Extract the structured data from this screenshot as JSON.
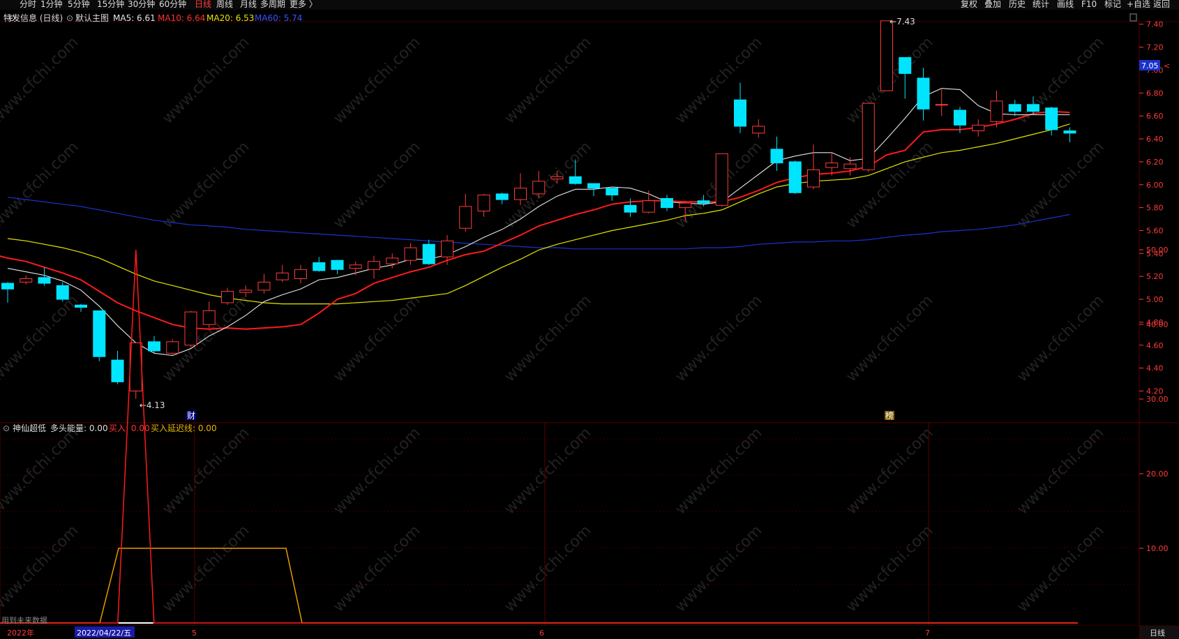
{
  "toolbar": {
    "left": [
      "分时",
      "1分钟",
      "5分钟",
      "15分钟",
      "30分钟",
      "60分钟",
      "日线",
      "周线",
      "月线",
      "多周期",
      "更多 〉"
    ],
    "active": "日线",
    "right": [
      "复权",
      "叠加",
      "历史",
      "统计",
      "画线",
      "F10",
      "标记",
      "+自选",
      "返回"
    ]
  },
  "main": {
    "stock_title": "特发信息 (日线)",
    "template_label": "默认主图",
    "ma5_label": "MA5: 6.61",
    "ma10_label": "MA10: 6.64",
    "ma20_label": "MA20: 6.53",
    "ma60_label": "MA60: 5.74",
    "high_marker": "7.43",
    "low_marker": "4.13",
    "current_price": "7.05",
    "event_cai": "财",
    "event_bang": "榜"
  },
  "sub": {
    "indicator_name": "神仙超低",
    "energy_label": "多头能量: 0.00",
    "buy_label": "买入: 0.00",
    "delay_label": "买入延迟线: 0.00",
    "future_note": "用到未来数据"
  },
  "bottom": {
    "year_label": "2022年",
    "selected_date": "2022/04/22/五",
    "month_5": "5",
    "month_6": "6",
    "month_7": "7",
    "period_tab": "日线"
  },
  "watermark": "www.cfchi.com",
  "colors": {
    "up": "#ff3b3b",
    "down": "#00e5ff",
    "ma5": "#e6e6e6",
    "ma10": "#ff1a1a",
    "ma20": "#e6e600",
    "ma60": "#1a33cc",
    "buy": "#ff1a1a",
    "delay": "#e69900",
    "bg": "#000000",
    "grid": "#3a0000"
  },
  "chart_data": {
    "type": "candlestick",
    "price_axis": {
      "min": 4.13,
      "max": 7.43,
      "ticks": [
        "7.40",
        "7.20",
        "7.00",
        "6.80",
        "6.60",
        "6.40",
        "6.20",
        "6.00",
        "5.80",
        "5.60",
        "5.40",
        "5.20",
        "5.00",
        "4.80",
        "4.60",
        "4.40",
        "4.20"
      ]
    },
    "candles": [
      [
        5.14,
        5.09,
        5.15,
        4.97
      ],
      [
        5.15,
        5.18,
        5.21,
        5.13
      ],
      [
        5.19,
        5.14,
        5.28,
        5.12
      ],
      [
        5.12,
        5.0,
        5.15,
        4.98
      ],
      [
        4.95,
        4.93,
        4.96,
        4.89
      ],
      [
        4.9,
        4.5,
        4.9,
        4.46
      ],
      [
        4.47,
        4.28,
        4.55,
        4.26
      ],
      [
        4.2,
        4.62,
        4.62,
        4.13
      ],
      [
        4.63,
        4.55,
        4.68,
        4.53
      ],
      [
        4.53,
        4.63,
        4.65,
        4.52
      ],
      [
        4.6,
        4.89,
        4.9,
        4.58
      ],
      [
        4.78,
        4.9,
        4.98,
        4.75
      ],
      [
        4.97,
        5.07,
        5.1,
        4.95
      ],
      [
        5.06,
        5.08,
        5.12,
        5.02
      ],
      [
        5.08,
        5.15,
        5.22,
        5.05
      ],
      [
        5.17,
        5.23,
        5.3,
        5.15
      ],
      [
        5.18,
        5.26,
        5.3,
        5.14
      ],
      [
        5.32,
        5.25,
        5.37,
        5.24
      ],
      [
        5.34,
        5.26,
        5.32,
        5.22
      ],
      [
        5.27,
        5.3,
        5.33,
        5.21
      ],
      [
        5.26,
        5.33,
        5.38,
        5.18
      ],
      [
        5.31,
        5.36,
        5.4,
        5.27
      ],
      [
        5.34,
        5.45,
        5.49,
        5.3
      ],
      [
        5.48,
        5.31,
        5.52,
        5.3
      ],
      [
        5.37,
        5.51,
        5.56,
        5.3
      ],
      [
        5.62,
        5.81,
        5.92,
        5.59
      ],
      [
        5.77,
        5.91,
        5.92,
        5.72
      ],
      [
        5.92,
        5.87,
        5.93,
        5.83
      ],
      [
        5.87,
        5.97,
        6.1,
        5.82
      ],
      [
        5.92,
        6.03,
        6.12,
        5.88
      ],
      [
        6.05,
        6.07,
        6.12,
        6.01
      ],
      [
        6.07,
        6.01,
        6.22,
        6.0
      ],
      [
        6.01,
        5.97,
        6.01,
        5.9
      ],
      [
        5.97,
        5.91,
        5.95,
        5.86
      ],
      [
        5.82,
        5.76,
        5.88,
        5.72
      ],
      [
        5.76,
        5.86,
        5.95,
        5.75
      ],
      [
        5.88,
        5.8,
        5.91,
        5.77
      ],
      [
        5.8,
        5.84,
        5.86,
        5.68
      ],
      [
        5.86,
        5.84,
        5.91,
        5.81
      ],
      [
        5.82,
        6.27,
        6.27,
        5.81
      ],
      [
        6.74,
        6.51,
        6.89,
        6.45
      ],
      [
        6.45,
        6.51,
        6.57,
        6.41
      ],
      [
        6.31,
        6.19,
        6.42,
        6.12
      ],
      [
        6.2,
        5.93,
        6.21,
        5.92
      ],
      [
        5.98,
        6.13,
        6.35,
        5.96
      ],
      [
        6.15,
        6.19,
        6.28,
        6.08
      ],
      [
        6.14,
        6.18,
        6.24,
        6.08
      ],
      [
        6.13,
        6.71,
        6.71,
        6.11
      ],
      [
        6.82,
        7.43,
        7.43,
        6.82
      ],
      [
        7.11,
        6.97,
        7.11,
        6.75
      ],
      [
        6.93,
        6.66,
        7.02,
        6.56
      ],
      [
        6.7,
        6.7,
        6.83,
        6.6
      ],
      [
        6.65,
        6.52,
        6.68,
        6.45
      ],
      [
        6.47,
        6.52,
        6.57,
        6.42
      ],
      [
        6.55,
        6.73,
        6.82,
        6.5
      ],
      [
        6.7,
        6.64,
        6.74,
        6.6
      ],
      [
        6.7,
        6.64,
        6.77,
        6.61
      ],
      [
        6.67,
        6.48,
        6.68,
        6.43
      ],
      [
        6.47,
        6.45,
        6.5,
        6.37
      ]
    ],
    "ma5": [
      5.27,
      5.24,
      5.21,
      5.16,
      5.08,
      4.94,
      4.77,
      4.62,
      4.53,
      4.51,
      4.57,
      4.68,
      4.76,
      4.86,
      4.98,
      5.04,
      5.09,
      5.17,
      5.19,
      5.23,
      5.27,
      5.3,
      5.35,
      5.35,
      5.39,
      5.46,
      5.54,
      5.61,
      5.7,
      5.81,
      5.9,
      5.96,
      5.96,
      5.98,
      5.97,
      5.92,
      5.85,
      5.84,
      5.83,
      5.85,
      5.97,
      6.09,
      6.21,
      6.25,
      6.28,
      6.28,
      6.21,
      6.23,
      6.4,
      6.58,
      6.77,
      6.84,
      6.83,
      6.69,
      6.62,
      6.61,
      6.61,
      6.61,
      6.61
    ],
    "ma10": [
      5.4,
      5.36,
      5.33,
      5.28,
      5.23,
      5.17,
      5.07,
      4.97,
      4.9,
      4.84,
      4.78,
      4.75,
      4.74,
      4.75,
      4.74,
      4.75,
      4.76,
      4.78,
      4.88,
      5.0,
      5.05,
      5.14,
      5.19,
      5.24,
      5.28,
      5.34,
      5.39,
      5.42,
      5.49,
      5.56,
      5.64,
      5.69,
      5.74,
      5.78,
      5.83,
      5.85,
      5.86,
      5.86,
      5.85,
      5.85,
      5.85,
      5.89,
      5.95,
      6.02,
      6.06,
      6.09,
      6.1,
      6.12,
      6.16,
      6.26,
      6.3,
      6.46,
      6.48,
      6.48,
      6.5,
      6.53,
      6.57,
      6.62,
      6.64,
      6.63
    ],
    "ma20": [
      5.53,
      5.51,
      5.48,
      5.45,
      5.41,
      5.36,
      5.29,
      5.22,
      5.16,
      5.12,
      5.08,
      5.04,
      5.01,
      4.99,
      4.97,
      4.96,
      4.96,
      4.96,
      4.96,
      4.97,
      4.98,
      4.99,
      5.01,
      5.03,
      5.05,
      5.12,
      5.2,
      5.28,
      5.35,
      5.43,
      5.48,
      5.52,
      5.56,
      5.6,
      5.63,
      5.66,
      5.69,
      5.73,
      5.75,
      5.78,
      5.85,
      5.92,
      5.98,
      6.01,
      6.03,
      6.04,
      6.05,
      6.08,
      6.14,
      6.2,
      6.24,
      6.28,
      6.3,
      6.33,
      6.36,
      6.4,
      6.44,
      6.48,
      6.53
    ],
    "ma60": [
      5.89,
      5.87,
      5.85,
      5.83,
      5.81,
      5.78,
      5.75,
      5.72,
      5.69,
      5.67,
      5.65,
      5.64,
      5.63,
      5.61,
      5.6,
      5.59,
      5.58,
      5.57,
      5.56,
      5.55,
      5.54,
      5.53,
      5.52,
      5.51,
      5.5,
      5.49,
      5.48,
      5.47,
      5.46,
      5.45,
      5.45,
      5.44,
      5.44,
      5.44,
      5.44,
      5.44,
      5.44,
      5.44,
      5.45,
      5.45,
      5.46,
      5.48,
      5.49,
      5.5,
      5.5,
      5.51,
      5.51,
      5.52,
      5.54,
      5.56,
      5.57,
      5.59,
      5.6,
      5.61,
      5.63,
      5.65,
      5.68,
      5.71,
      5.74
    ],
    "sub_axis": {
      "min": 0,
      "max": 50,
      "ticks": [
        "50.00",
        "40.00",
        "30.00",
        "20.00",
        "10.00"
      ]
    },
    "buy": [
      0,
      0,
      0,
      0,
      0,
      0,
      0,
      50,
      0,
      0,
      0,
      0,
      0,
      0,
      0,
      0,
      0,
      0,
      0,
      0,
      0,
      0,
      0,
      0,
      0,
      0,
      0,
      0,
      0,
      0,
      0,
      0,
      0,
      0,
      0,
      0,
      0,
      0,
      0,
      0,
      0,
      0,
      0,
      0,
      0,
      0,
      0,
      0,
      0,
      0,
      0,
      0,
      0,
      0,
      0,
      0,
      0,
      0,
      0
    ],
    "delay": [
      0,
      0,
      0,
      0,
      0,
      0,
      10,
      10,
      10,
      10,
      10,
      10,
      10,
      10,
      10,
      10,
      0,
      0,
      0,
      0,
      0,
      0,
      0,
      0,
      0,
      0,
      0,
      0,
      0,
      0,
      0,
      0,
      0,
      0,
      0,
      0,
      0,
      0,
      0,
      0,
      0,
      0,
      0,
      0,
      0,
      0,
      0,
      0,
      0,
      0,
      0,
      0,
      0,
      0,
      0,
      0,
      0,
      0,
      0
    ]
  }
}
